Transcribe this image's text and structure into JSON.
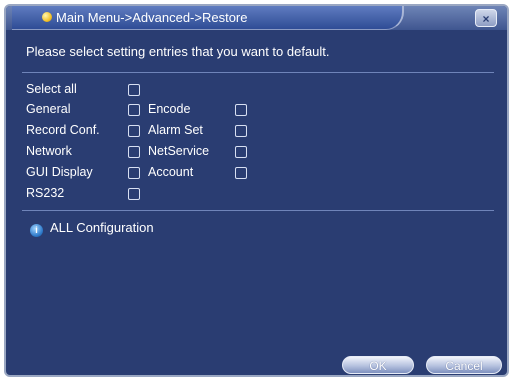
{
  "title": "Main Menu->Advanced->Restore",
  "close_icon": "×",
  "prompt": "Please select setting entries that you want to default.",
  "options": {
    "select_all": "Select all",
    "general": "General",
    "encode": "Encode",
    "record_conf": "Record Conf.",
    "alarm_set": "Alarm Set",
    "network": "Network",
    "netservice": "NetService",
    "gui_display": "GUI Display",
    "account": "Account",
    "rs232": "RS232"
  },
  "info": {
    "icon": "info-icon",
    "text": "ALL Configuration"
  },
  "buttons": {
    "ok": "OK",
    "cancel": "Cancel"
  },
  "colors": {
    "window_bg": "#2a3d72",
    "title_gradient_top": "#5f7cc0",
    "title_gradient_bottom": "#2f4c95",
    "text": "#ffffff"
  }
}
